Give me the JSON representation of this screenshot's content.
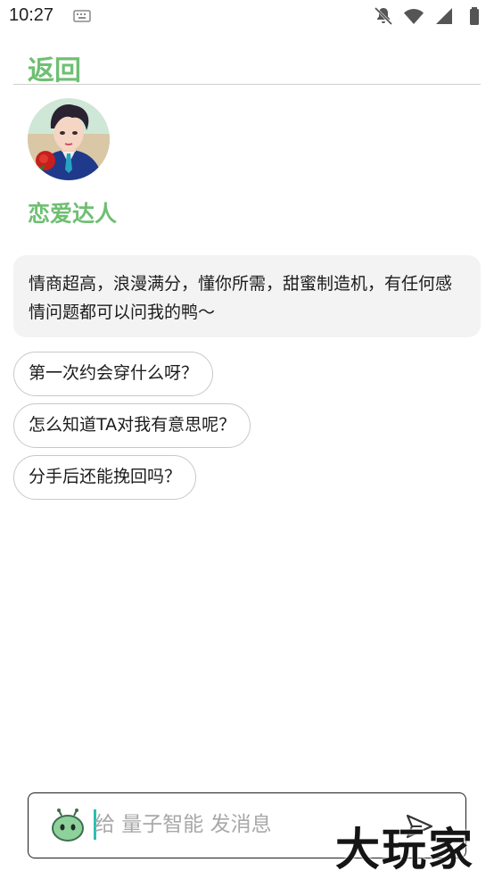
{
  "status_bar": {
    "time": "10:27",
    "icons": [
      "keyboard-icon",
      "notifications-off-icon",
      "wifi-icon",
      "signal-icon",
      "battery-icon"
    ]
  },
  "header": {
    "back_label": "返回"
  },
  "bot": {
    "name": "恋爱达人",
    "avatar": "avatar-illustration-man-with-rose",
    "intro": "情商超高，浪漫满分，懂你所需，甜蜜制造机，有任何感情问题都可以问我的鸭～"
  },
  "suggestions": [
    {
      "label": "第一次约会穿什么呀？"
    },
    {
      "label": "怎么知道TA对我有意思呢？"
    },
    {
      "label": "分手后还能挽回吗？"
    }
  ],
  "composer": {
    "placeholder": "给 量子智能 发消息",
    "value": "",
    "bot_icon": "robot-icon",
    "send_icon": "send-icon"
  },
  "watermark": "大玩家",
  "colors": {
    "accent": "#6fbf73",
    "card_bg": "#f3f3f3",
    "cursor": "#2bbfb0",
    "border": "#c8c8c8"
  }
}
